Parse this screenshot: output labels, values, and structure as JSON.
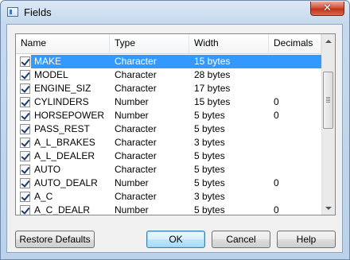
{
  "window": {
    "title": "Fields"
  },
  "columns": [
    "Name",
    "Type",
    "Width",
    "Decimals"
  ],
  "rows": [
    {
      "name": "MAKE",
      "type": "Character",
      "width": "15 bytes",
      "decimals": "",
      "checked": true,
      "selected": true
    },
    {
      "name": "MODEL",
      "type": "Character",
      "width": "28 bytes",
      "decimals": "",
      "checked": true
    },
    {
      "name": "ENGINE_SIZ",
      "type": "Character",
      "width": "17 bytes",
      "decimals": "",
      "checked": true
    },
    {
      "name": "CYLINDERS",
      "type": "Number",
      "width": "15 bytes",
      "decimals": "0",
      "checked": true
    },
    {
      "name": "HORSEPOWER",
      "type": "Number",
      "width": "5 bytes",
      "decimals": "0",
      "checked": true
    },
    {
      "name": "PASS_REST",
      "type": "Character",
      "width": "5 bytes",
      "decimals": "",
      "checked": true
    },
    {
      "name": "A_L_BRAKES",
      "type": "Character",
      "width": "3 bytes",
      "decimals": "",
      "checked": true
    },
    {
      "name": "A_L_DEALER",
      "type": "Character",
      "width": "5 bytes",
      "decimals": "",
      "checked": true
    },
    {
      "name": "AUTO",
      "type": "Character",
      "width": "5 bytes",
      "decimals": "",
      "checked": true
    },
    {
      "name": "AUTO_DEALR",
      "type": "Number",
      "width": "5 bytes",
      "decimals": "0",
      "checked": true
    },
    {
      "name": "A_C",
      "type": "Character",
      "width": "3 bytes",
      "decimals": "",
      "checked": true
    },
    {
      "name": "A_C_DEALR",
      "type": "Number",
      "width": "5 bytes",
      "decimals": "0",
      "checked": true
    }
  ],
  "buttons": {
    "restore": "Restore Defaults",
    "ok": "OK",
    "cancel": "Cancel",
    "help": "Help"
  },
  "colors": {
    "selection": "#3399ff"
  }
}
